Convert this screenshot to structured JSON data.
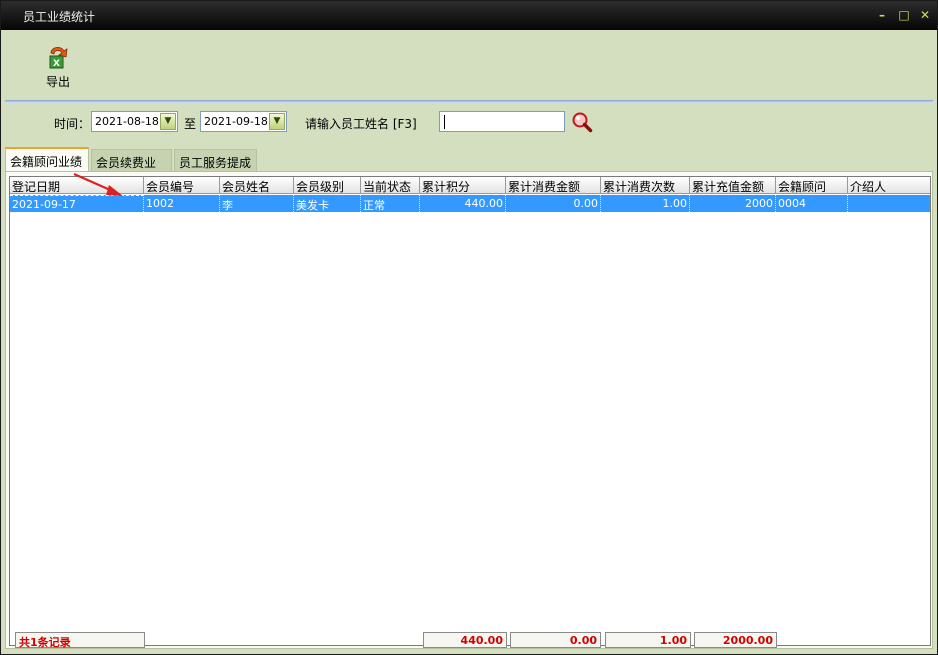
{
  "window": {
    "title": "员工业绩统计",
    "btn_min": "–",
    "btn_max": "□",
    "btn_close": "✕"
  },
  "toolbar": {
    "export_label": "导出"
  },
  "filter": {
    "time_label": "时间：",
    "date_from": "2021-08-18",
    "to_label": "至",
    "date_to": "2021-09-18",
    "name_label": "请输入员工姓名 [F3]",
    "name_value": ""
  },
  "tabs": [
    {
      "label": "会籍顾问业绩"
    },
    {
      "label": "会员续费业绩"
    },
    {
      "label": "员工服务提成"
    }
  ],
  "table": {
    "columns": [
      "登记日期",
      "会员编号",
      "会员姓名",
      "会员级别",
      "当前状态",
      "累计积分",
      "累计消费金额",
      "累计消费次数",
      "累计充值金额",
      "会籍顾问",
      "介绍人"
    ],
    "rows": [
      [
        "2021-09-17",
        "1002",
        "李",
        "美发卡",
        "正常",
        "440.00",
        "0.00",
        "1.00",
        "2000",
        "0004",
        ""
      ]
    ]
  },
  "footer": {
    "record_count": "共1条记录",
    "total_points": "440.00",
    "total_spend": "0.00",
    "total_visits": "1.00",
    "total_recharge": "2000.00"
  },
  "colors": {
    "selection": "#3399ff",
    "footer_text": "#d40000",
    "accent_tab": "#f0a030"
  }
}
